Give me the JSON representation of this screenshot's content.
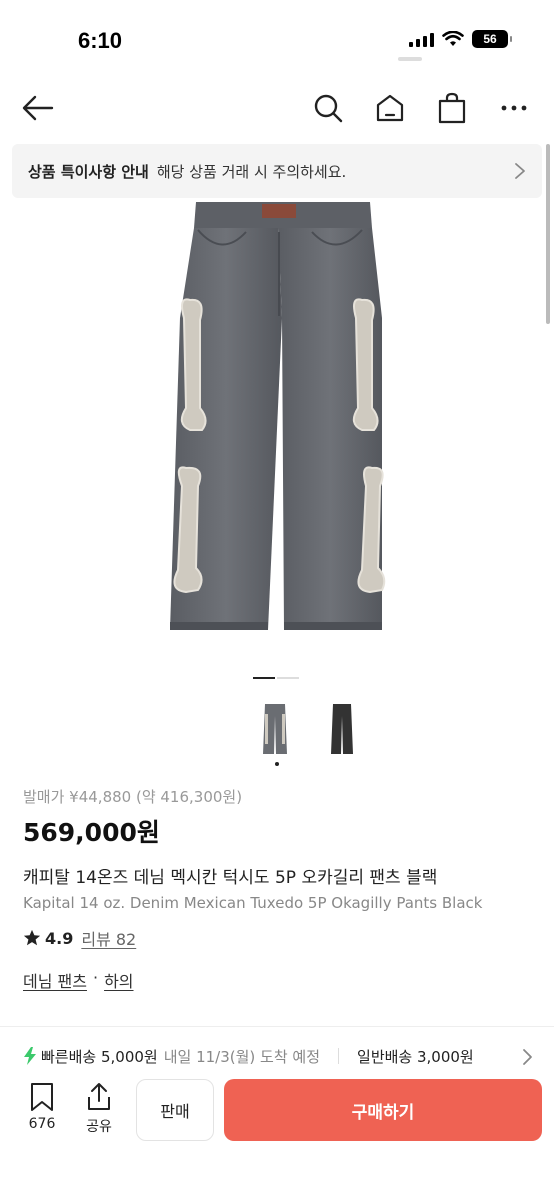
{
  "status": {
    "time": "6:10",
    "battery": "56"
  },
  "notice": {
    "title": "상품 특이사항 안내",
    "text": "해당 상품 거래 시 주의하세요."
  },
  "product": {
    "release_price": "발매가 ¥44,880 (약 416,300원)",
    "price": "569,000원",
    "name_ko": "캐피탈 14온즈 데님 멕시칸 턱시도 5P 오카길리 팬츠 블랙",
    "name_en": "Kapital 14 oz. Denim Mexican Tuxedo 5P Okagilly Pants Black",
    "rating": "4.9",
    "review": "리뷰 82",
    "category": [
      "데님 팬츠",
      "·",
      "하의"
    ],
    "pager": {
      "count": 2,
      "active": 1
    },
    "thumbnail_count": 2
  },
  "shipping": {
    "fast_label": "빠른배송 5,000원",
    "fast_eta": "내일 11/3(월) 도착 예정",
    "normal_label": "일반배송 3,000원"
  },
  "bottom_bar": {
    "bookmark_count": "676",
    "share_label": "공유",
    "sell_label": "판매",
    "buy_label": "구매하기"
  },
  "colors": {
    "accent": "#ef6253",
    "fast_ship": "#3bc96b"
  }
}
